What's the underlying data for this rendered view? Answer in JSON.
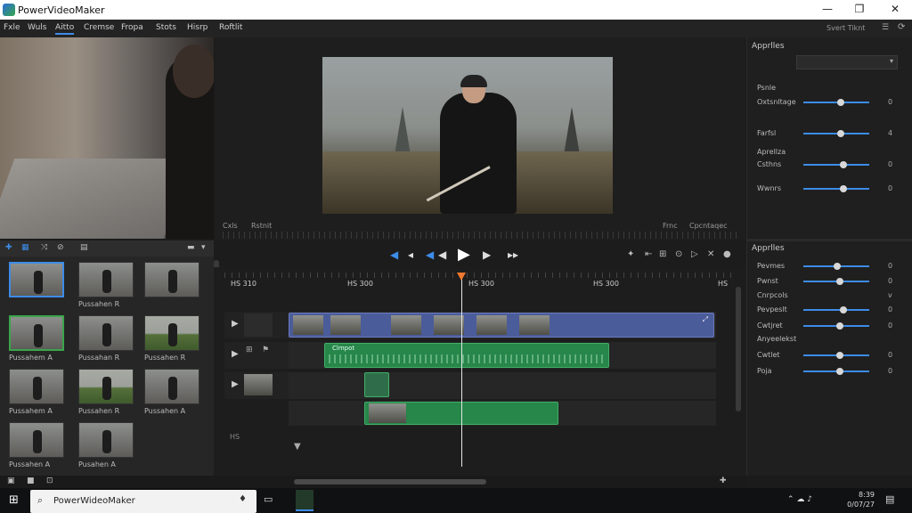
{
  "app": {
    "title": "PowerVideoMaker"
  },
  "window_controls": {
    "minimize": "—",
    "maximize": "❐",
    "close": "✕"
  },
  "menu": {
    "items": [
      "Fxle",
      "Wuls",
      "Aitto",
      "Cremse",
      "Fropa",
      "Stots",
      "Hisrp",
      "Roftlit"
    ],
    "active_index": 2
  },
  "topright": {
    "label": "Svert Tiknt",
    "icons": [
      "list-icon",
      "help-icon"
    ]
  },
  "viewer": {
    "left_label": "Cxls",
    "left_label2": "Rstnit",
    "right_label": "Frnc",
    "right_label2": "Cpcntaqec"
  },
  "transport": {
    "buttons": [
      "◀",
      "◂",
      "◀",
      "◀",
      "▶",
      "▶",
      "▸▸"
    ],
    "right_icons": [
      "✦",
      "⇤",
      "⊞",
      "⊙",
      "▷",
      "✕",
      "●"
    ]
  },
  "timeline": {
    "timecodes": [
      "HS 310",
      "HS 300",
      "HS 300",
      "HS 300",
      "HS"
    ],
    "clip_label_green": "Clmpot",
    "bottom_label": "HS"
  },
  "medialib": {
    "thumbs": [
      {
        "label": "",
        "style": "sel"
      },
      {
        "label": "Pussahen R",
        "style": ""
      },
      {
        "label": "",
        "style": ""
      },
      {
        "label": "Pussahem A",
        "style": "gsel"
      },
      {
        "label": "Pussahan R",
        "style": ""
      },
      {
        "label": "Pussahen R",
        "style": "grass"
      },
      {
        "label": "Pussahem A",
        "style": ""
      },
      {
        "label": "Pussahen R",
        "style": "grass"
      },
      {
        "label": "Pussahen A",
        "style": ""
      },
      {
        "label": "Pussahen A",
        "style": ""
      },
      {
        "label": "Pusahen A",
        "style": ""
      }
    ]
  },
  "rightpanel": {
    "section1_title": "Apprlles",
    "section1_items": [
      {
        "label": "Psnle",
        "value": null
      },
      {
        "label": "Oxtsnltage",
        "value": 0.57,
        "display": "0"
      },
      {
        "label": "Farfsl",
        "value": 0.57,
        "display": "4"
      },
      {
        "label": "Aprellza",
        "value": null
      },
      {
        "label": "Csthns",
        "value": 0.61,
        "display": "0"
      },
      {
        "label": "Wwnrs",
        "value": 0.61,
        "display": "0"
      }
    ],
    "section2_title": "Apprlles",
    "section2_items": [
      {
        "label": "Pevmes",
        "value": 0.51,
        "display": "0"
      },
      {
        "label": "Pwnst",
        "value": 0.55,
        "display": "0"
      },
      {
        "label": "Cnrpcols",
        "value": null,
        "display": "v"
      },
      {
        "label": "Pevpeslt",
        "value": 0.61,
        "display": "0"
      },
      {
        "label": "Cwtjret",
        "value": 0.55,
        "display": "0"
      },
      {
        "label": "Anyeelekst",
        "value": null
      },
      {
        "label": "Cwtlet",
        "value": 0.55,
        "display": "0"
      },
      {
        "label": "Poja",
        "value": 0.55,
        "display": "0"
      }
    ]
  },
  "taskbar": {
    "search_text": "PowerWideoMaker",
    "time": "8:39",
    "date": "0/07/27"
  }
}
